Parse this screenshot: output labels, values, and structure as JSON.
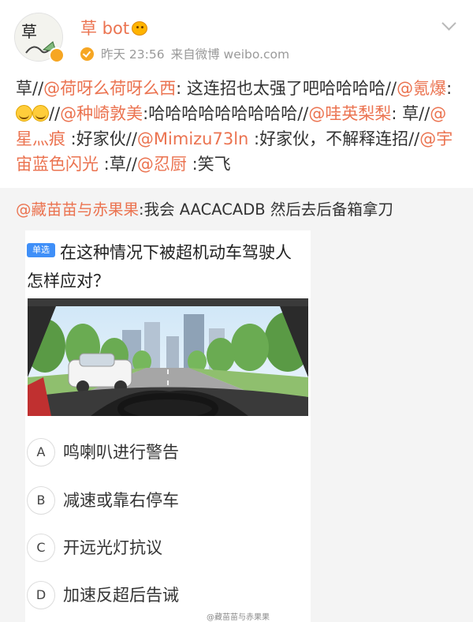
{
  "header": {
    "username": "草 bot",
    "vip_icon": "crown-face-emoji",
    "verified_icon": "verified-badge",
    "time": "昨天 23:56",
    "source": "来自微博 weibo.com"
  },
  "post": {
    "segments": [
      {
        "t": "草//",
        "m": false
      },
      {
        "t": "@荷呀么荷呀么西",
        "m": true
      },
      {
        "t": ": 这连招也太强了吧哈哈哈哈//",
        "m": false
      },
      {
        "t": "@氪爆",
        "m": true
      },
      {
        "t": ":",
        "m": false
      },
      {
        "emoji": "laughing-crying-emoji"
      },
      {
        "emoji": "laughing-crying-emoji"
      },
      {
        "t": "//",
        "m": false
      },
      {
        "t": "@种崎敦美",
        "m": true
      },
      {
        "t": ":哈哈哈哈哈哈哈哈哈//",
        "m": false
      },
      {
        "t": "@哇英梨梨",
        "m": true
      },
      {
        "t": ": 草//",
        "m": false
      },
      {
        "t": "@星灬痕",
        "m": true
      },
      {
        "t": " :好家伙//",
        "m": false
      },
      {
        "t": "@Mimizu73ln",
        "m": true
      },
      {
        "t": " :好家伙，不解释连招//",
        "m": false
      },
      {
        "t": "@宇宙蓝色闪光",
        "m": true
      },
      {
        "t": " :草//",
        "m": false
      },
      {
        "t": "@忍厨",
        "m": true
      },
      {
        "t": " :笑飞",
        "m": false
      }
    ]
  },
  "repost": {
    "mention": "@藏苗苗与赤果果",
    "text": ":我会 AACACADB 然后去后备箱拿刀"
  },
  "quiz": {
    "badge": "单选",
    "question": "在这种情况下被超机动车驾驶人怎样应对？",
    "image_alt": "driver-view-road-scene",
    "options": [
      {
        "letter": "A",
        "text": "鸣喇叭进行警告"
      },
      {
        "letter": "B",
        "text": "减速或靠右停车"
      },
      {
        "letter": "C",
        "text": "开远光灯抗议"
      },
      {
        "letter": "D",
        "text": "加速反超后告诫"
      }
    ]
  },
  "watermark": "@藏苗苗与赤果果",
  "colors": {
    "mention": "#eb7350",
    "badge": "#3f8ff8",
    "background_gray": "#f4f4f4"
  }
}
